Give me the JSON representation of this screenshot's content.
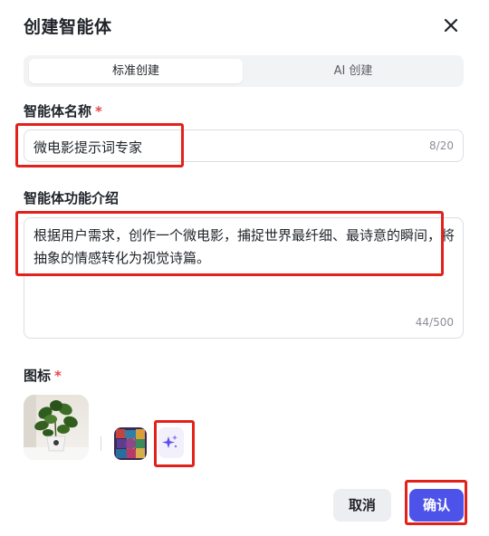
{
  "dialog": {
    "title": "创建智能体",
    "close_icon": "close-icon"
  },
  "tabs": [
    {
      "label": "标准创建",
      "active": true
    },
    {
      "label": "AI 创建",
      "active": false
    }
  ],
  "name_field": {
    "label": "智能体名称",
    "required_mark": "*",
    "value": "微电影提示词专家",
    "counter": "8/20"
  },
  "description_field": {
    "label": "智能体功能介绍",
    "value": "根据用户需求，创作一个微电影，捕捉世界最纤细、最诗意的瞬间，将抽象的情感转化为视觉诗篇。",
    "counter": "44/500"
  },
  "icon_field": {
    "label": "图标",
    "required_mark": "*",
    "ai_generate_icon": "sparkle-icon"
  },
  "footer": {
    "cancel_label": "取消",
    "confirm_label": "确认"
  },
  "colors": {
    "primary": "#4d53e8",
    "highlight": "#e3211b",
    "required": "#e5484d"
  }
}
